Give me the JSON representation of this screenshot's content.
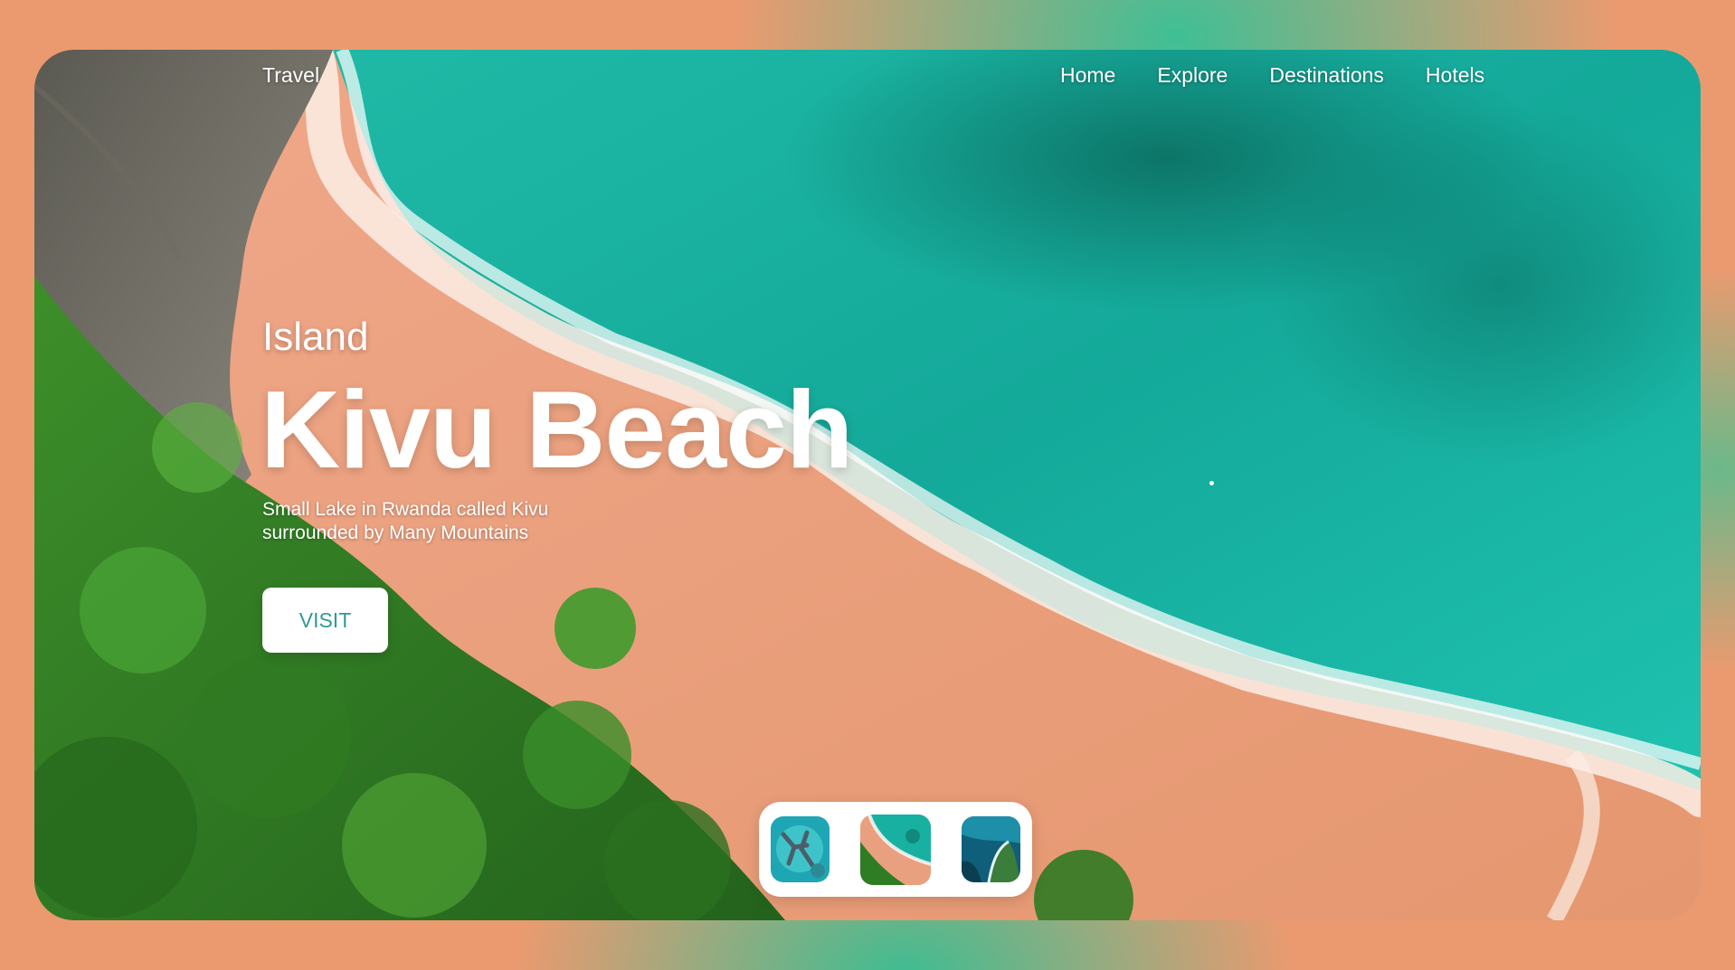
{
  "nav": {
    "brand": "Travel",
    "links": [
      "Home",
      "Explore",
      "Destinations",
      "Hotels"
    ]
  },
  "hero": {
    "kicker": "Island",
    "title": "Kivu Beach",
    "subtitle_line1": "Small Lake in Rwanda called Kivu",
    "subtitle_line2": "surrounded by Many Mountains",
    "cta_label": "VISIT"
  },
  "gallery": {
    "thumbnails": [
      "island-aerial",
      "beach-aerial",
      "coast-cliff"
    ],
    "active_index": 1
  },
  "colors": {
    "page_bg": "#eb9a6f",
    "accent_green": "#3fbf95",
    "sea": "#19b5a2",
    "sand": "#e9a07f",
    "jungle": "#2e7d24",
    "cta_text": "#2f9a96"
  }
}
